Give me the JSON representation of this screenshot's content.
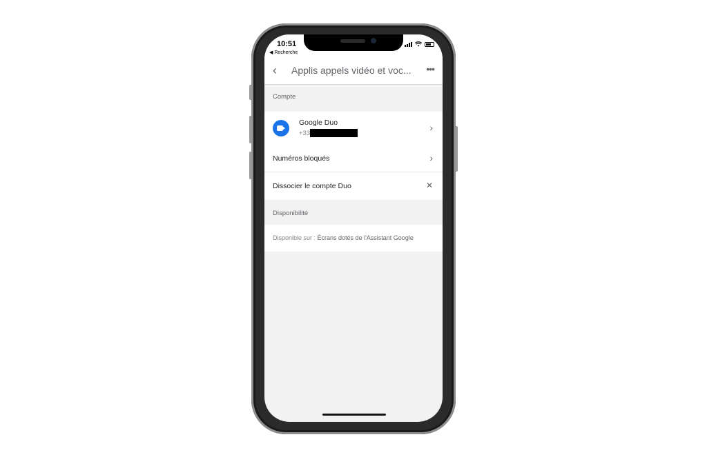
{
  "status_bar": {
    "time": "10:51",
    "back_app": "◀ Recherche"
  },
  "header": {
    "back_icon": "‹",
    "title": "Applis appels vidéo et voc...",
    "more_icon": "•••"
  },
  "sections": {
    "account": {
      "label": "Compte"
    },
    "availability": {
      "label": "Disponibilité"
    }
  },
  "account": {
    "app_name": "Google Duo",
    "phone_prefix": "+33",
    "blocked_numbers": "Numéros bloqués",
    "unlink": "Dissocier le compte Duo"
  },
  "availability": {
    "label_prefix": "Disponible sur : ",
    "value": "Écrans dotés de l'Assistant Google"
  },
  "icons": {
    "chevron": "›",
    "close": "✕"
  },
  "colors": {
    "duo_blue": "#1a73e8",
    "background": "#f2f2f2"
  }
}
